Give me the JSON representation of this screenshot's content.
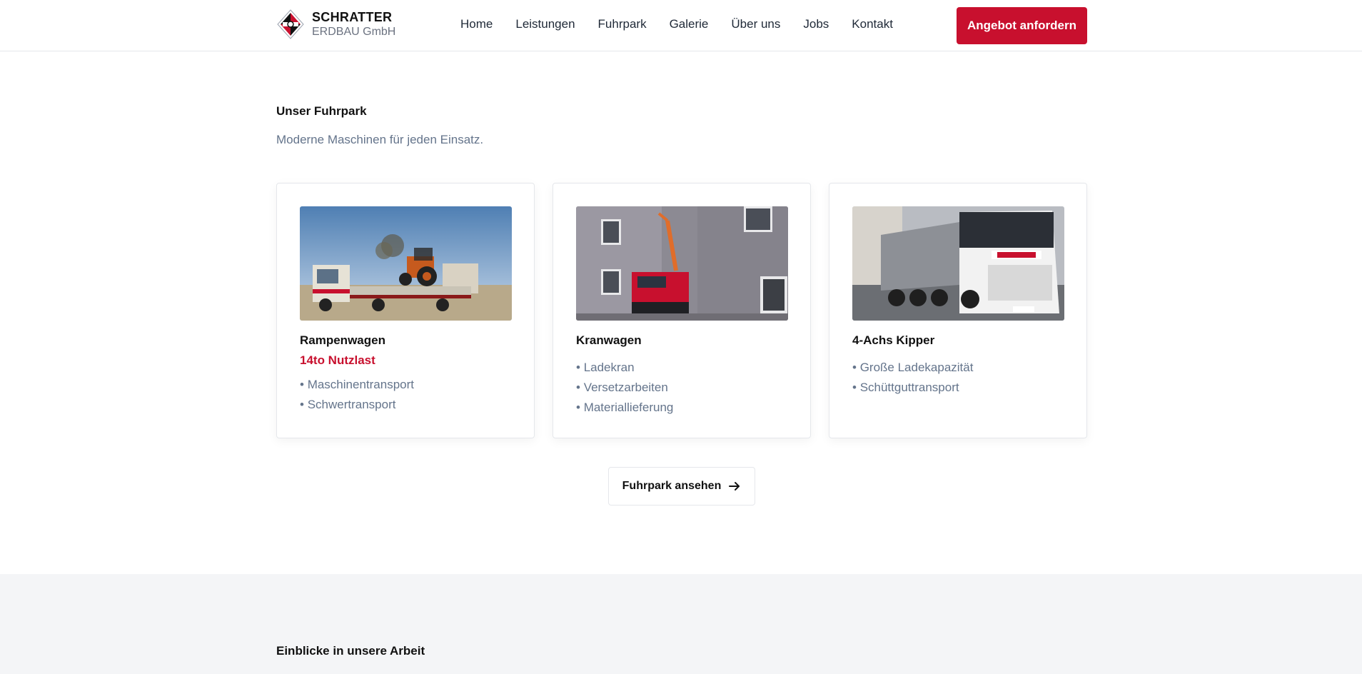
{
  "header": {
    "brand_title": "SCHRATTER",
    "brand_sub": "ERDBAU GmbH",
    "nav": [
      "Home",
      "Leistungen",
      "Fuhrpark",
      "Galerie",
      "Über uns",
      "Jobs",
      "Kontakt"
    ],
    "cta_label": "Angebot anfordern"
  },
  "fleet": {
    "title": "Unser Fuhrpark",
    "subtitle": "Moderne Maschinen für jeden Einsatz.",
    "cards": [
      {
        "title": "Rampenwagen",
        "highlight": "14to Nutzlast",
        "items": [
          "Maschinentransport",
          "Schwertransport"
        ]
      },
      {
        "title": "Kranwagen",
        "items": [
          "Ladekran",
          "Versetzarbeiten",
          "Materiallieferung"
        ]
      },
      {
        "title": "4-Achs Kipper",
        "items": [
          "Große Ladekapazität",
          "Schüttguttransport"
        ]
      }
    ],
    "more_label": "Fuhrpark ansehen"
  },
  "insights": {
    "title": "Einblicke in unsere Arbeit"
  },
  "colors": {
    "accent": "#c8102e",
    "muted": "#64748b",
    "section_bg": "#f4f5f7"
  },
  "icons": {
    "logo": "schratter-logo-icon",
    "more": "arrow-right-icon"
  }
}
